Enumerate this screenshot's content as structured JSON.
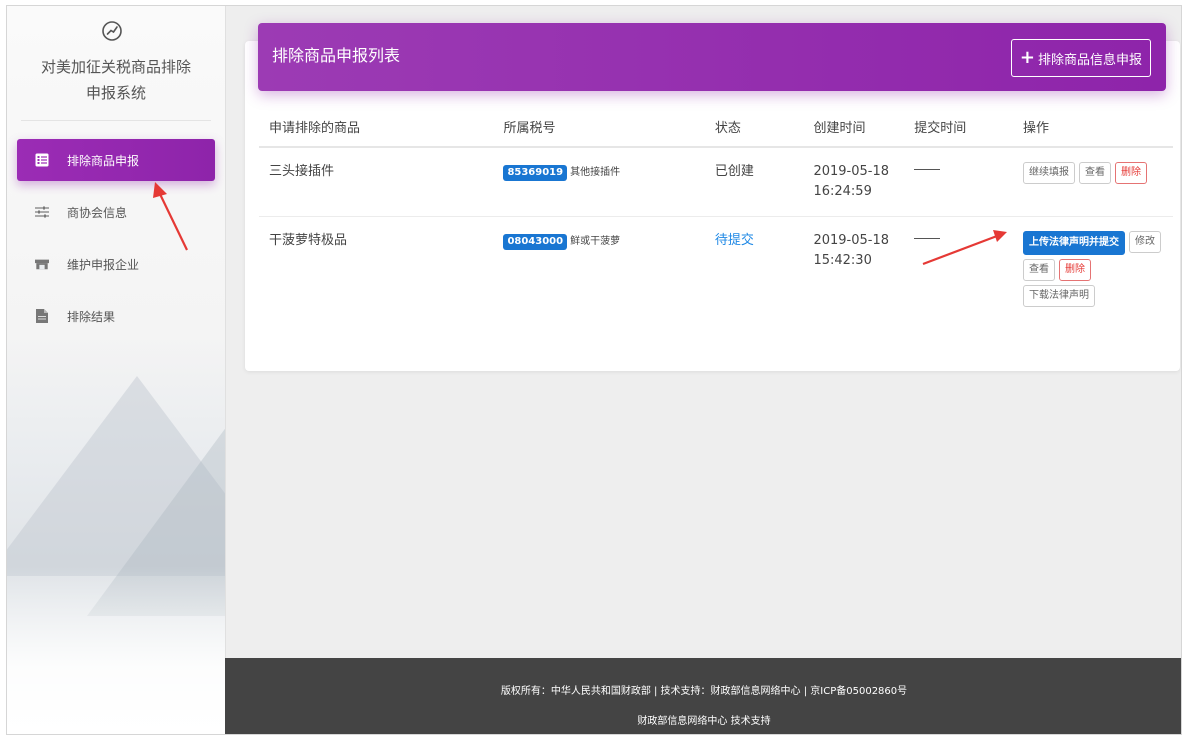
{
  "sidebar": {
    "brand_title_line1": "对美加征关税商品排除",
    "brand_title_line2": "申报系统",
    "brand_icon": "check-circle-icon",
    "items": [
      {
        "label": "排除商品申报",
        "icon": "list-icon",
        "active": true
      },
      {
        "label": "商协会信息",
        "icon": "sliders-icon",
        "active": false
      },
      {
        "label": "维护申报企业",
        "icon": "store-icon",
        "active": false
      },
      {
        "label": "排除结果",
        "icon": "document-icon",
        "active": false
      }
    ]
  },
  "header": {
    "title": "排除商品申报列表",
    "declare_button": "排除商品信息申报"
  },
  "table": {
    "columns": [
      "申请排除的商品",
      "所属税号",
      "状态",
      "创建时间",
      "提交时间",
      "操作"
    ],
    "rows": [
      {
        "product": "三头接插件",
        "tax_code": "85369019",
        "tax_desc": "其他接插件",
        "status": "已创建",
        "created_date": "2019-05-18",
        "created_time": "16:24:59",
        "submitted": "",
        "actions": [
          "继续填报",
          "查看",
          "删除"
        ]
      },
      {
        "product": "干菠萝特极品",
        "tax_code": "08043000",
        "tax_desc": "鲜或干菠萝",
        "status": "待提交",
        "created_date": "2019-05-18",
        "created_time": "15:42:30",
        "submitted": "",
        "actions": [
          "上传法律声明并提交",
          "修改",
          "查看",
          "删除",
          "下载法律声明"
        ]
      }
    ]
  },
  "footer": {
    "line1": "版权所有：中华人民共和国财政部 | 技术支持：财政部信息网络中心 | 京ICP备05002860号",
    "line2": "财政部信息网络中心 技术支持"
  },
  "colors": {
    "accent_purple": "#8e24aa",
    "primary_blue": "#1976d2",
    "danger_red": "#e53935",
    "annotation_red": "#e53935"
  }
}
